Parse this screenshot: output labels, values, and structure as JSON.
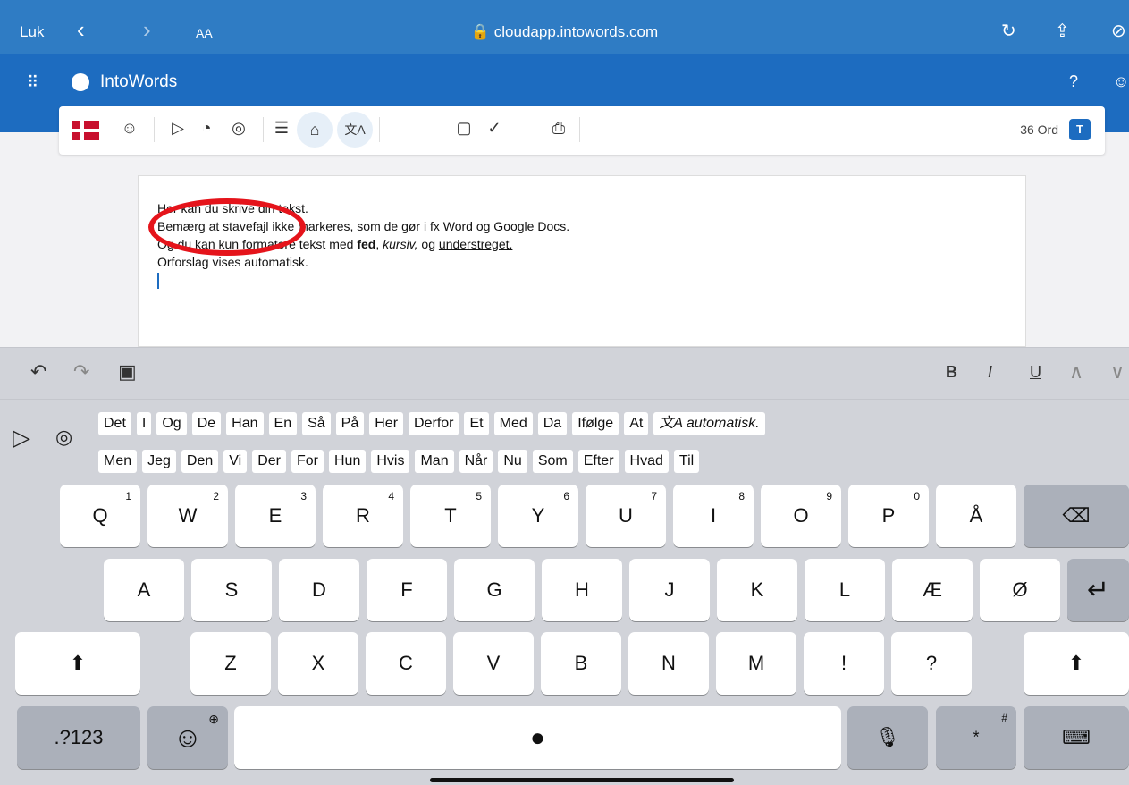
{
  "browser": {
    "close_label": "Luk",
    "back_icon": "‹",
    "forward_icon": "›",
    "text_size_label": "AA",
    "url": "🔒 cloudapp.intowords.com",
    "reload_icon": "↻",
    "share_icon": "⇪",
    "compass_icon": "⊘"
  },
  "app": {
    "grid_icon": "⠿",
    "title": "IntoWords",
    "help_icon": "?",
    "account_icon": "☺"
  },
  "toolbar": {
    "voice_icon": "☺",
    "play_icon": "▷",
    "speed_icon": "◔",
    "prediction_icon": "◎",
    "list_icon": "☰",
    "learn_icon": "⌂",
    "translate_icon": "文A",
    "folder_icon": "▢",
    "check_icon": "✓",
    "print_icon": "⎙",
    "word_count": "36 Ord",
    "t_button": "T"
  },
  "document": {
    "line1": "Her kan du skrive din tekst.",
    "line2": "Bemærg at stavefajl ikke markeres, som de gør i fx Word og Google Docs.",
    "line3_a": "Og du kan kun formatere tekst med ",
    "line3_bold": "fed",
    "line3_b": ", ",
    "line3_italic": "kursiv,",
    "line3_c": " og ",
    "line3_underline": "understreget.",
    "line4": "Orforslag vises automatisk."
  },
  "keyboard_toolbar": {
    "undo_icon": "↶",
    "redo_icon": "↷",
    "paste_icon": "▣",
    "bold_label": "B",
    "italic_label": "I",
    "underline_label": "U",
    "up_icon": "∧",
    "down_icon": "∨"
  },
  "suggestions": {
    "play_icon": "▷",
    "bubble_icon": "◎",
    "row1": [
      "Det",
      "I",
      "Og",
      "De",
      "Han",
      "En",
      "Så",
      "På",
      "Her",
      "Derfor",
      "Et",
      "Med",
      "Da",
      "Ifølge",
      "At",
      "文A automatisk."
    ],
    "row2": [
      "Men",
      "Jeg",
      "Den",
      "Vi",
      "Der",
      "For",
      "Hun",
      "Hvis",
      "Man",
      "Når",
      "Nu",
      "Som",
      "Efter",
      "Hvad",
      "Til"
    ]
  },
  "keys": {
    "row1": [
      {
        "l": "Q",
        "s": "1"
      },
      {
        "l": "W",
        "s": "2"
      },
      {
        "l": "E",
        "s": "3"
      },
      {
        "l": "R",
        "s": "4"
      },
      {
        "l": "T",
        "s": "5"
      },
      {
        "l": "Y",
        "s": "6"
      },
      {
        "l": "U",
        "s": "7"
      },
      {
        "l": "I",
        "s": "8"
      },
      {
        "l": "O",
        "s": "9"
      },
      {
        "l": "P",
        "s": "0"
      },
      {
        "l": "Å",
        "s": ""
      }
    ],
    "backspace_icon": "⌫",
    "row2": [
      "A",
      "S",
      "D",
      "F",
      "G",
      "H",
      "J",
      "K",
      "L",
      "Æ",
      "Ø"
    ],
    "return_icon": "↵",
    "shift_icon": "⬆",
    "row3": [
      "Z",
      "X",
      "C",
      "V",
      "B",
      "N",
      "M",
      "!",
      "?"
    ],
    "numbers_label": ".?123",
    "emoji_icon": "☺",
    "globe_icon": "⊕",
    "space_icon": "●",
    "mic_icon": "🎙",
    "star_label": "*",
    "hash_label": "#",
    "hide_keyboard_icon": "⌨"
  }
}
